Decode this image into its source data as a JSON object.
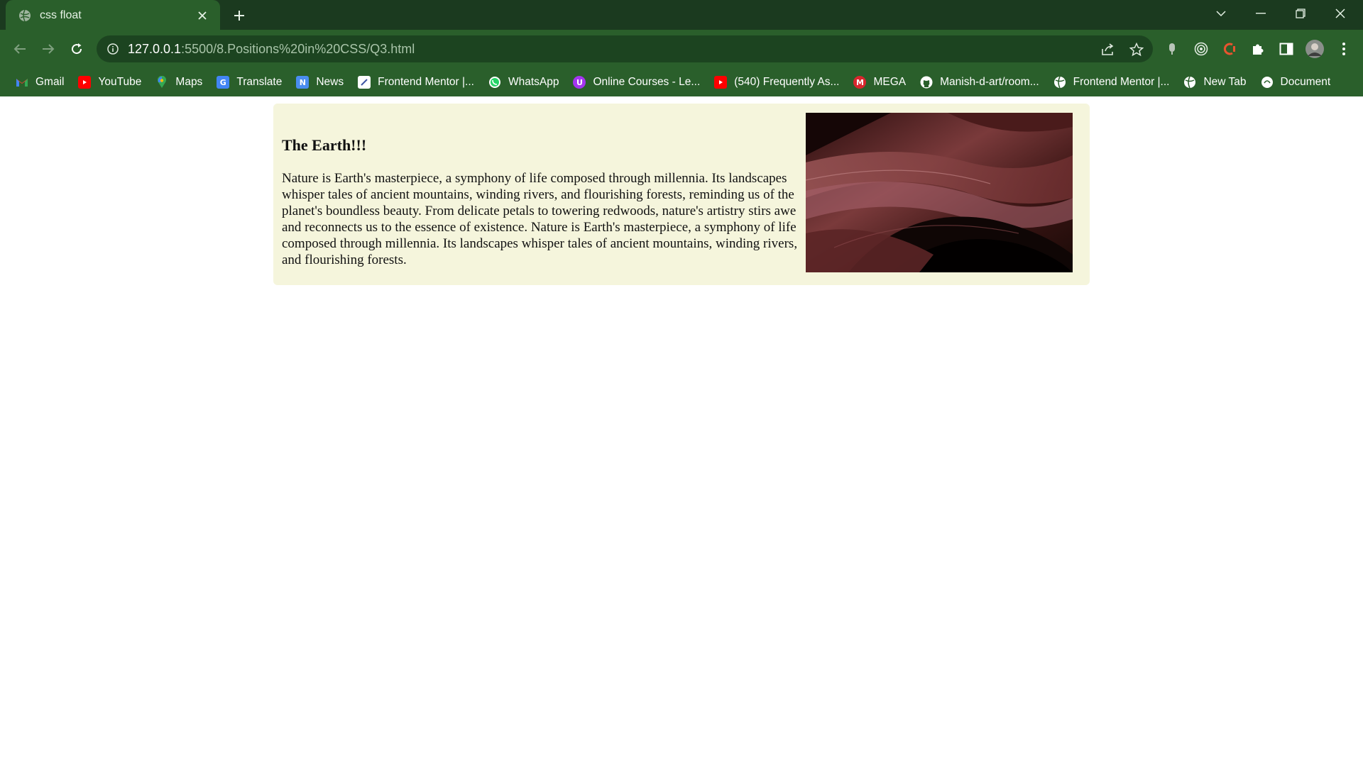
{
  "browser": {
    "tab": {
      "title": "css float"
    },
    "url": {
      "host": "127.0.0.1",
      "path": ":5500/8.Positions%20in%20CSS/Q3.html"
    },
    "bookmarks": [
      {
        "label": "Gmail",
        "icon": "gmail-icon",
        "color": "#ea4335"
      },
      {
        "label": "YouTube",
        "icon": "youtube-icon",
        "color": "#ff0000"
      },
      {
        "label": "Maps",
        "icon": "maps-icon",
        "color": "#34a853"
      },
      {
        "label": "Translate",
        "icon": "translate-icon",
        "color": "#4285f4"
      },
      {
        "label": "News",
        "icon": "news-icon",
        "color": "#4a8df0"
      },
      {
        "label": "Frontend Mentor |...",
        "icon": "frontend-mentor-icon",
        "color": "#ffffff"
      },
      {
        "label": "WhatsApp",
        "icon": "whatsapp-icon",
        "color": "#25d366"
      },
      {
        "label": "Online Courses - Le...",
        "icon": "udemy-icon",
        "color": "#a435f0"
      },
      {
        "label": "(540) Frequently As...",
        "icon": "youtube-icon",
        "color": "#ff0000"
      },
      {
        "label": "MEGA",
        "icon": "mega-icon",
        "color": "#d9272e"
      },
      {
        "label": "Manish-d-art/room...",
        "icon": "github-icon",
        "color": "#ffffff"
      },
      {
        "label": "Frontend Mentor |...",
        "icon": "globe-icon",
        "color": "#ffffff"
      },
      {
        "label": "New Tab",
        "icon": "globe-icon",
        "color": "#ffffff"
      },
      {
        "label": "Document",
        "icon": "document-icon",
        "color": "#ffffff"
      }
    ],
    "theme": {
      "frame": "#1b3a1f",
      "toolbar": "#2a5f2b",
      "omnibox": "#1c4420"
    }
  },
  "page": {
    "heading": "The Earth!!!",
    "paragraph": "Nature is Earth's masterpiece, a symphony of life composed through millennia. Its landscapes whisper tales of ancient mountains, winding rivers, and flourishing forests, reminding us of the planet's boundless beauty. From delicate petals to towering redwoods, nature's artistry stirs awe and reconnects us to the essence of existence. Nature is Earth's masterpiece, a symphony of life composed through millennia. Its landscapes whisper tales of ancient mountains, winding rivers, and flourishing forests.",
    "card_background": "#f5f5dc",
    "image": {
      "description_icon": "abstract-wave-image"
    }
  }
}
